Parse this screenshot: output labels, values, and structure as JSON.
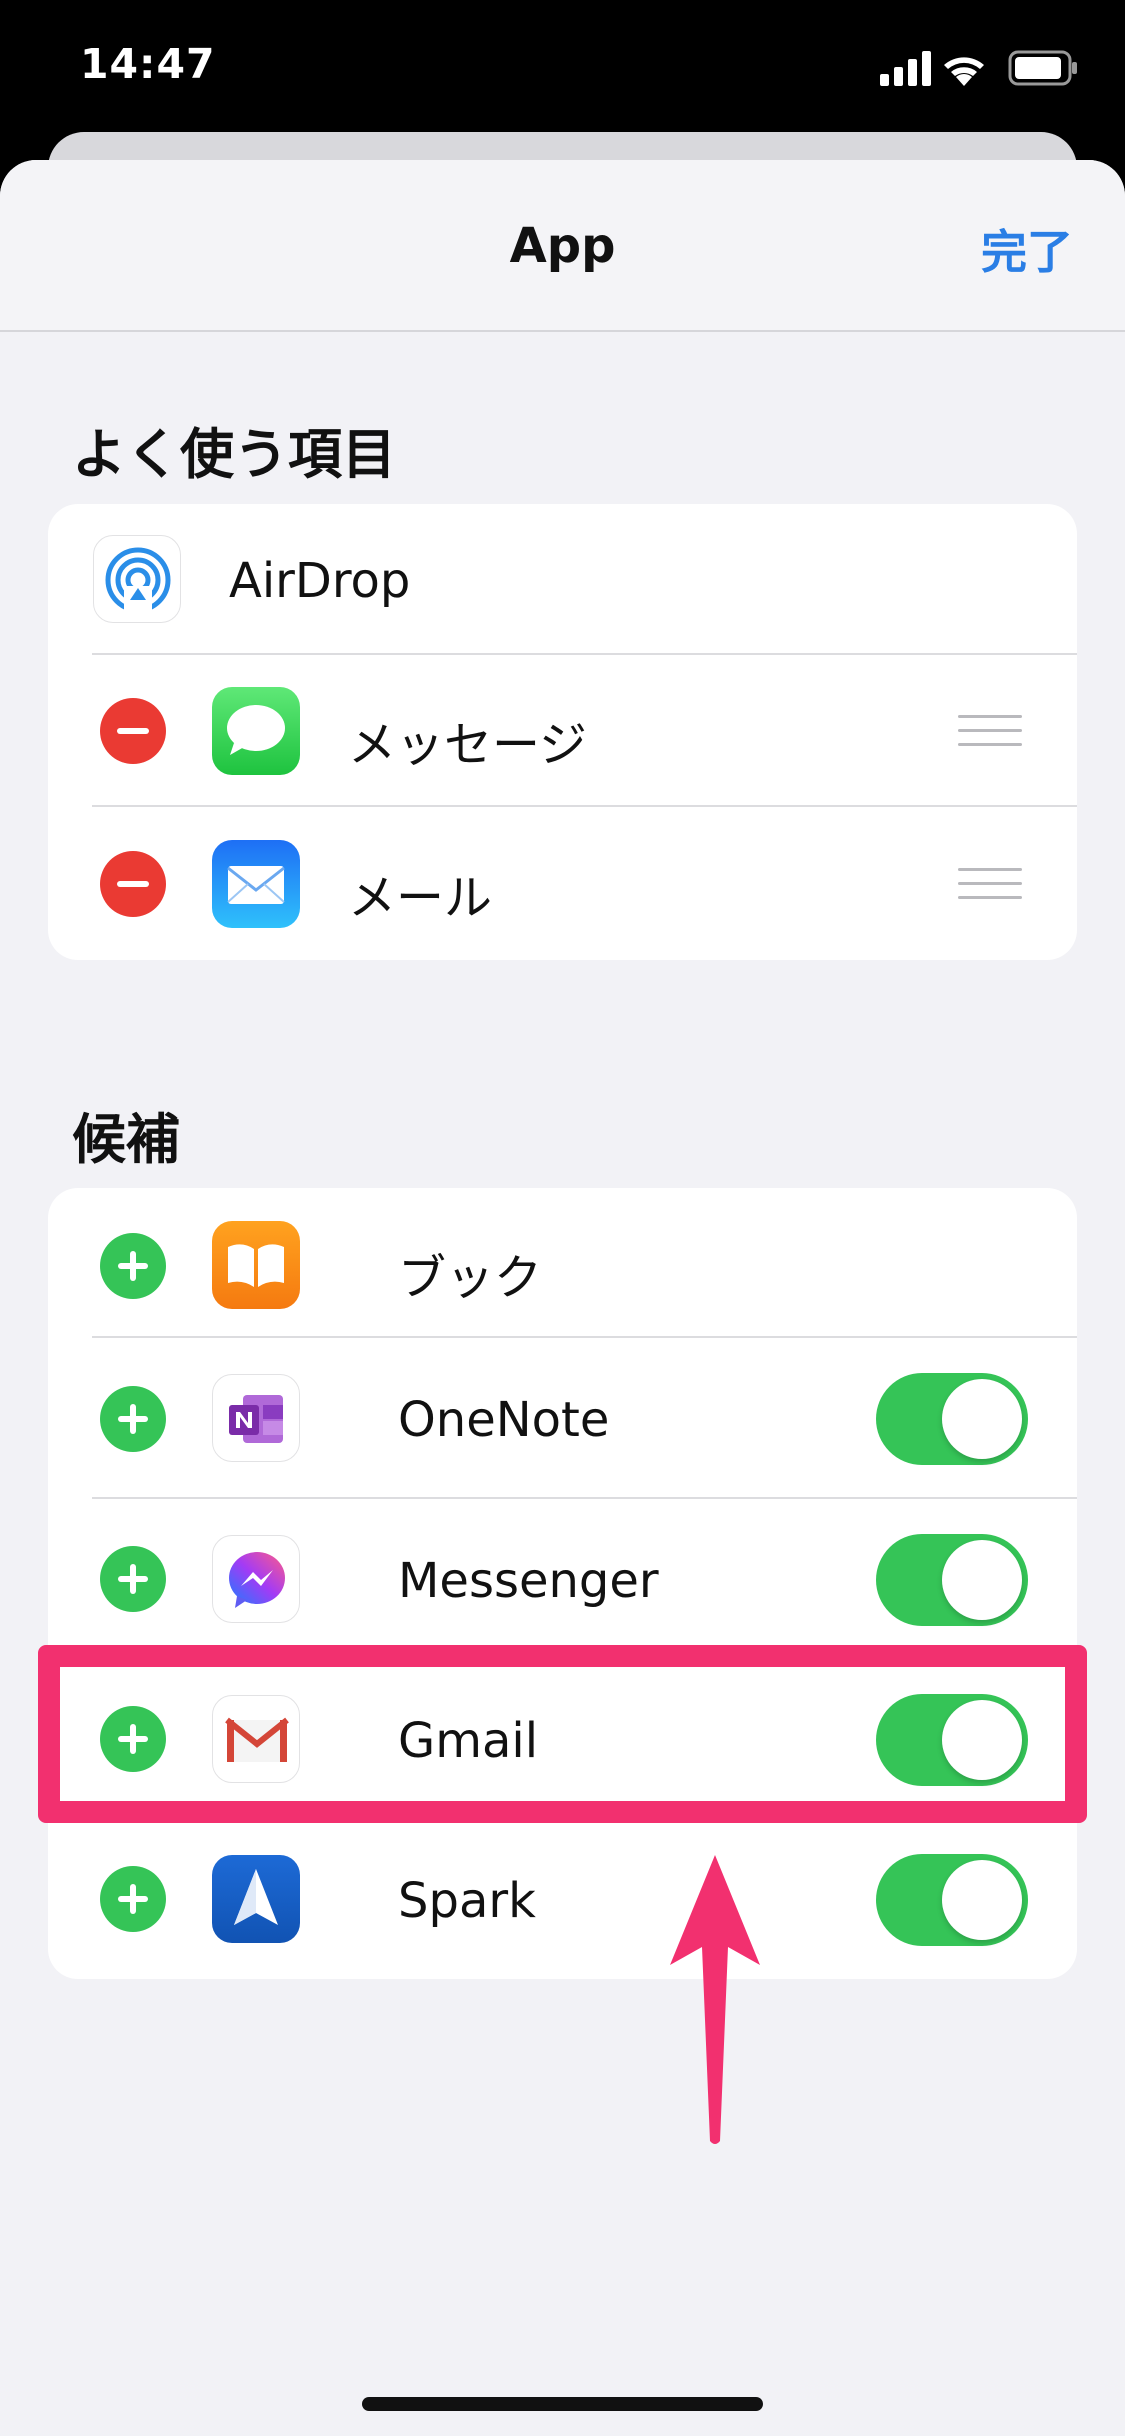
{
  "status_bar": {
    "time": "14:47"
  },
  "nav": {
    "title": "App",
    "done_label": "完了"
  },
  "favorites": {
    "header": "よく使う項目",
    "items": [
      {
        "label": "AirDrop",
        "icon": "airdrop-icon"
      },
      {
        "label": "メッセージ",
        "icon": "messages-icon"
      },
      {
        "label": "メール",
        "icon": "mail-icon"
      }
    ]
  },
  "suggestions": {
    "header": "候補",
    "items": [
      {
        "label": "ブック",
        "icon": "books-icon"
      },
      {
        "label": "OneNote",
        "icon": "onenote-icon",
        "toggle_on": true
      },
      {
        "label": "Messenger",
        "icon": "messenger-icon",
        "toggle_on": true
      },
      {
        "label": "Gmail",
        "icon": "gmail-icon",
        "toggle_on": true
      },
      {
        "label": "Spark",
        "icon": "spark-icon",
        "toggle_on": true
      }
    ]
  },
  "colors": {
    "accent_blue": "#2a7ee5",
    "toggle_green": "#35c457",
    "delete_red": "#ea3a33",
    "highlight_pink": "#f2306f"
  }
}
